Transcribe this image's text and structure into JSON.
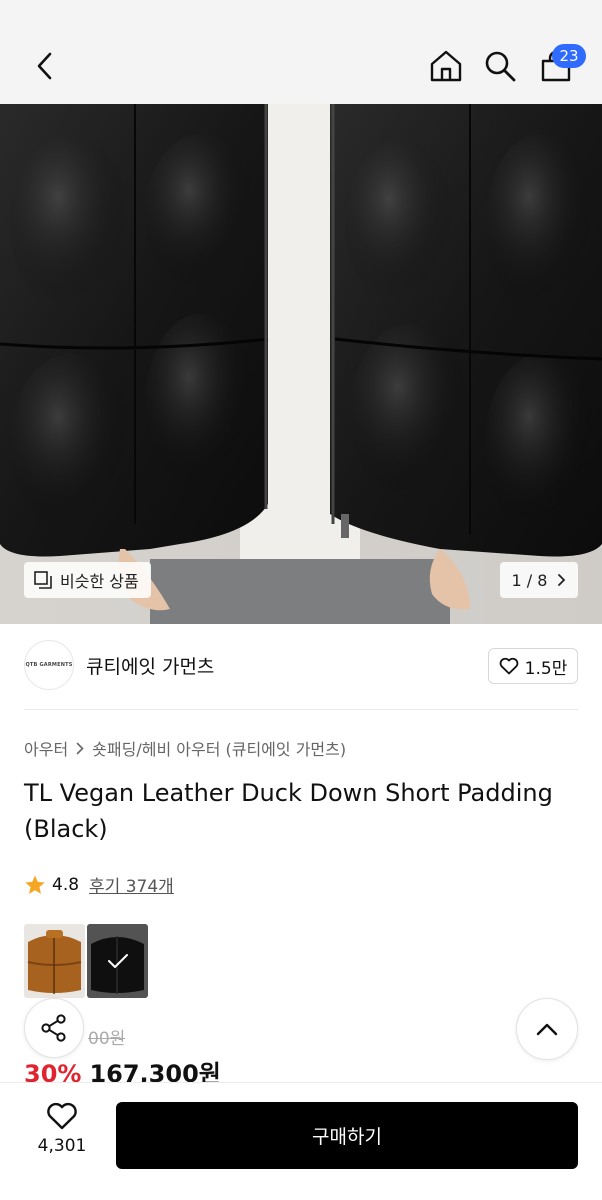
{
  "header": {
    "back_icon": "chevron-left-icon",
    "home_icon": "home-icon",
    "search_icon": "search-icon",
    "bag_icon": "shopping-bag-icon",
    "bag_count": "23"
  },
  "gallery": {
    "similar_label": "비슷한 상품",
    "pager_text": "1 / 8"
  },
  "brand": {
    "logo_text": "QTB GARMENTS",
    "name": "큐티에잇 가먼츠",
    "likes": "1.5만"
  },
  "breadcrumb": {
    "category": "아우터",
    "subcategory": "숏패딩/헤비 아우터 (큐티에잇 가먼츠)"
  },
  "product": {
    "title": "TL Vegan Leather Duck Down Short Padding (Black)",
    "rating": "4.8",
    "reviews": "후기 374개",
    "original_price": "00원",
    "discount": "30%",
    "price": "167,300원"
  },
  "bottom": {
    "wish_count": "4,301",
    "buy_label": "구매하기"
  },
  "colors": {
    "accent_blue": "#2f6bff",
    "discount_red": "#e0242f",
    "star": "#f5a623"
  }
}
